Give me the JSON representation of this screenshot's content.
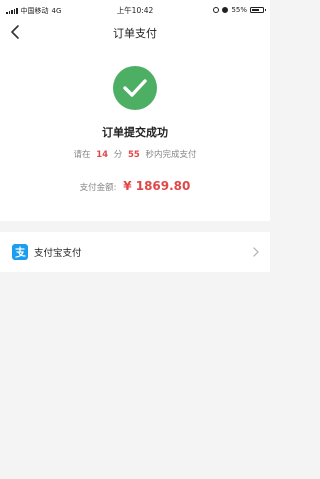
{
  "status_bar": {
    "carrier": "中国移动",
    "network": "4G",
    "time": "上午10:42",
    "battery": "55%",
    "battery_level": 0.55
  },
  "nav": {
    "title": "订单支付",
    "back_icon": "chevron-left-icon"
  },
  "result": {
    "icon": "check-icon",
    "title": "订单提交成功",
    "countdown_prefix": "请在",
    "minutes": "14",
    "minutes_unit": "分",
    "seconds": "55",
    "seconds_suffix": "秒内完成支付",
    "amount_label": "支付金额:",
    "amount": "¥ 1869.80"
  },
  "payment": {
    "method_label": "支付宝支付",
    "method_icon": "alipay-icon",
    "chevron_icon": "chevron-right-icon"
  },
  "colors": {
    "success": "#4caf64",
    "price": "#e04848",
    "alipay": "#1b9df0"
  }
}
